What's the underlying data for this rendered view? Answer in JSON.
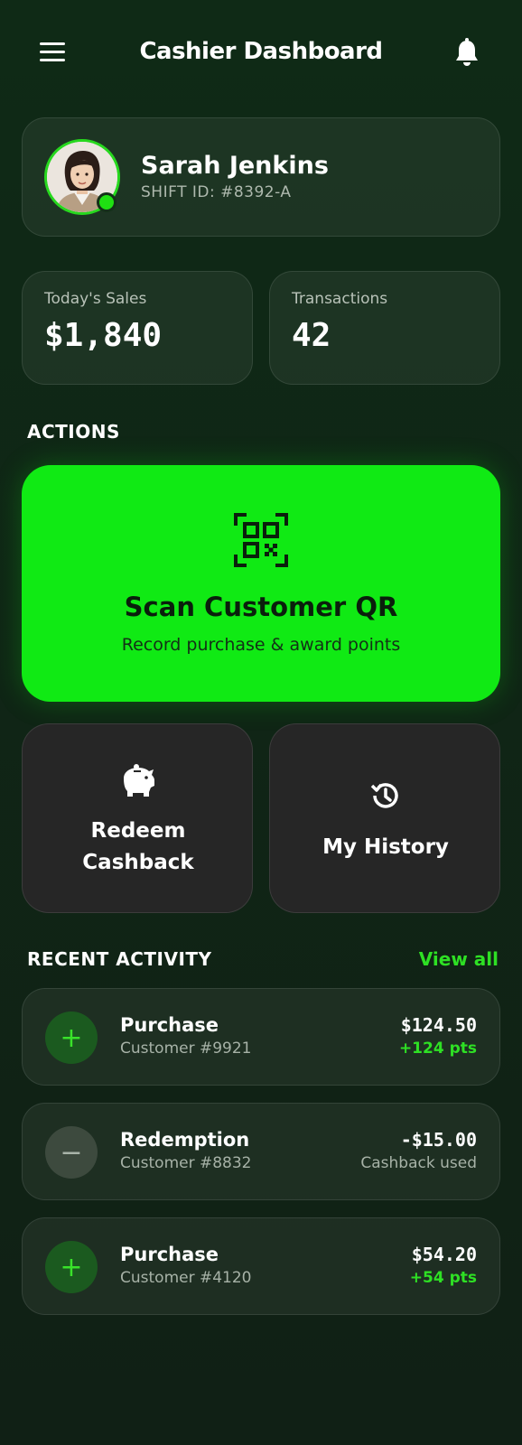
{
  "header": {
    "title": "Cashier Dashboard"
  },
  "profile": {
    "name": "Sarah Jenkins",
    "shift": "SHIFT ID: #8392-A"
  },
  "stats": [
    {
      "label": "Today's Sales",
      "value": "$1,840"
    },
    {
      "label": "Transactions",
      "value": "42"
    }
  ],
  "actions": {
    "title": "ACTIONS",
    "scan": {
      "title": "Scan Customer QR",
      "subtitle": "Record purchase & award points"
    },
    "redeem": {
      "line1": "Redeem",
      "line2": "Cashback"
    },
    "history": {
      "label": "My History"
    }
  },
  "recent": {
    "title": "RECENT ACTIVITY",
    "view_all": "View all",
    "items": [
      {
        "type": "Purchase",
        "customer": "Customer #9921",
        "amount": "$124.50",
        "sub": "+124 pts"
      },
      {
        "type": "Redemption",
        "customer": "Customer #8832",
        "amount": "-$15.00",
        "sub": "Cashback used"
      },
      {
        "type": "Purchase",
        "customer": "Customer #4120",
        "amount": "$54.20",
        "sub": "+54 pts"
      }
    ]
  },
  "colors": {
    "accent": "#10ea14",
    "background": "#0f2a16",
    "tile": "#262626"
  }
}
